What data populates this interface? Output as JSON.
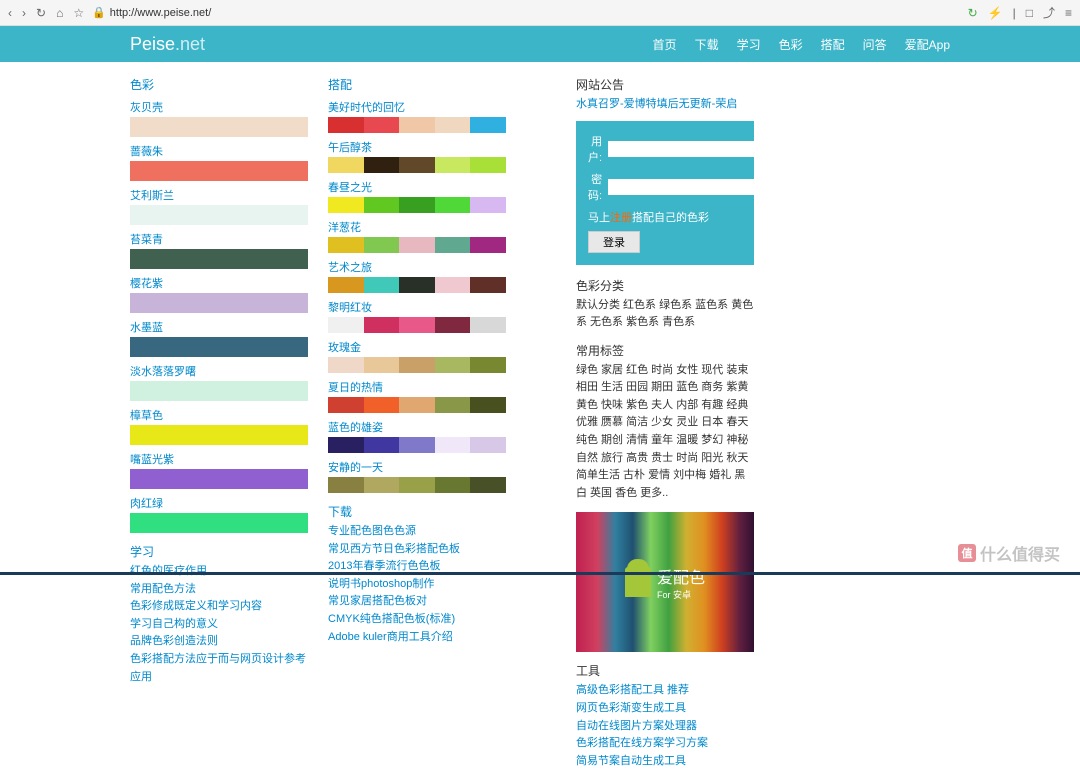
{
  "browser": {
    "url": "http://www.peise.net/"
  },
  "header": {
    "logo_main": "Peise",
    "logo_sub": ".net",
    "nav": [
      "首页",
      "下载",
      "学习",
      "色彩",
      "搭配",
      "问答",
      "爱配App"
    ]
  },
  "col1": {
    "title": "色彩",
    "items": [
      {
        "name": "灰贝壳",
        "color": "#f0dcc8"
      },
      {
        "name": "蔷薇朱",
        "color": "#f07060"
      },
      {
        "name": "艾利斯兰",
        "color": "#e8f4f0"
      },
      {
        "name": "苔菜青",
        "color": "#406050"
      },
      {
        "name": "樱花紫",
        "color": "#c8b4d8"
      },
      {
        "name": "水墨蓝",
        "color": "#386880"
      },
      {
        "name": "淡水落落罗曙",
        "color": "#d0f0e0"
      },
      {
        "name": "樟草色",
        "color": "#e8e818"
      },
      {
        "name": "嘴蓝光紫",
        "color": "#9060d0"
      },
      {
        "name": "肉红绿",
        "color": "#30e080"
      }
    ]
  },
  "col2": {
    "title": "搭配",
    "items": [
      {
        "name": "美好时代的回忆",
        "colors": [
          "#d83030",
          "#e84850",
          "#f0c8a8",
          "#f0d8c0",
          "#30b0e0"
        ]
      },
      {
        "name": "午后醇茶",
        "colors": [
          "#f0d860",
          "#302010",
          "#604828",
          "#c8e860",
          "#a8e038"
        ]
      },
      {
        "name": "春昼之光",
        "colors": [
          "#f0e820",
          "#60c820",
          "#38a020",
          "#50d838",
          "#d8b8f0"
        ]
      },
      {
        "name": "洋葱花",
        "colors": [
          "#e0c020",
          "#80c850",
          "#e8b8c0",
          "#60a890",
          "#a02880"
        ]
      },
      {
        "name": "艺术之旅",
        "colors": [
          "#d89820",
          "#40c8b8",
          "#283028",
          "#f0c8d0",
          "#603028"
        ]
      },
      {
        "name": "黎明红妆",
        "colors": [
          "#f0f0f0",
          "#d03060",
          "#e85888",
          "#802840",
          "#d8d8d8"
        ]
      },
      {
        "name": "玫瑰金",
        "colors": [
          "#f0d8c8",
          "#e8c898",
          "#c8a068",
          "#a8b860",
          "#788830"
        ]
      },
      {
        "name": "夏日的热情",
        "colors": [
          "#d04030",
          "#f06028",
          "#e0a870",
          "#889848",
          "#485020"
        ]
      },
      {
        "name": "蓝色的雄姿",
        "colors": [
          "#282060",
          "#4038a0",
          "#8078c8",
          "#f0e8f8",
          "#d8c8e8"
        ]
      },
      {
        "name": "安静的一天",
        "colors": [
          "#888040",
          "#b0a860",
          "#98a048",
          "#687830",
          "#485028"
        ]
      }
    ]
  },
  "sidebar": {
    "notice": {
      "title": "网站公告",
      "text": "水真召罗-爱博特填后无更新-荣启"
    },
    "login": {
      "user_label": "用户:",
      "pass_label": "密码:",
      "hint_pre": "马上",
      "hint_reg": "注册",
      "hint_post": "搭配自己的色彩",
      "btn": "登录"
    },
    "categories": {
      "title": "色彩分类",
      "text": "默认分类 红色系 绿色系 蓝色系 黄色系 无色系 紫色系 青色系"
    },
    "tags": {
      "title": "常用标签",
      "text": "绿色 家居 红色 时尚 女性 现代 装束 相田 生活 田园 期田 蓝色 商务 紫黄 黄色 快味 紫色 夫人 内部 有趣 经典 优雅 赝慕 简洁 少女 灵业 日本 春天 纯色 期创 清情 童年 温暖 梦幻 神秘 自然 旅行 高贵 贵士 时尚 阳光 秋天 简单生活 古朴 爱情 刘中梅 婚礼 黑白 英国 香色 更多.."
    },
    "app": {
      "name": "爱配色",
      "sub": "For 安卓"
    },
    "tools": {
      "title": "工具",
      "links": [
        "高级色彩搭配工具 推荐",
        "网页色彩渐变生成工具",
        "自动在线图片方案处理器",
        "色彩搭配在线方案学习方案",
        "简易节案自动生成工具"
      ]
    }
  },
  "col1_bottom": {
    "title": "学习",
    "links": [
      "红色的医疗作用",
      "常用配色方法",
      "色彩修成既定义和学习内容",
      "学习自己构的意义",
      "品牌色彩创造法则",
      "色彩搭配方法应于而与网页设计参考应用"
    ]
  },
  "col2_bottom": {
    "title": "下载",
    "links": [
      "专业配色图色色源",
      "常见西方节日色彩搭配色板",
      "2013年春季流行色色板",
      "说明书photoshop制作",
      "常见家居搭配色板对",
      "CMYK纯色搭配色板(标准)",
      "Adobe kuler商用工具介绍"
    ]
  },
  "brand": {
    "icon": "值",
    "text": "什么值得买"
  }
}
